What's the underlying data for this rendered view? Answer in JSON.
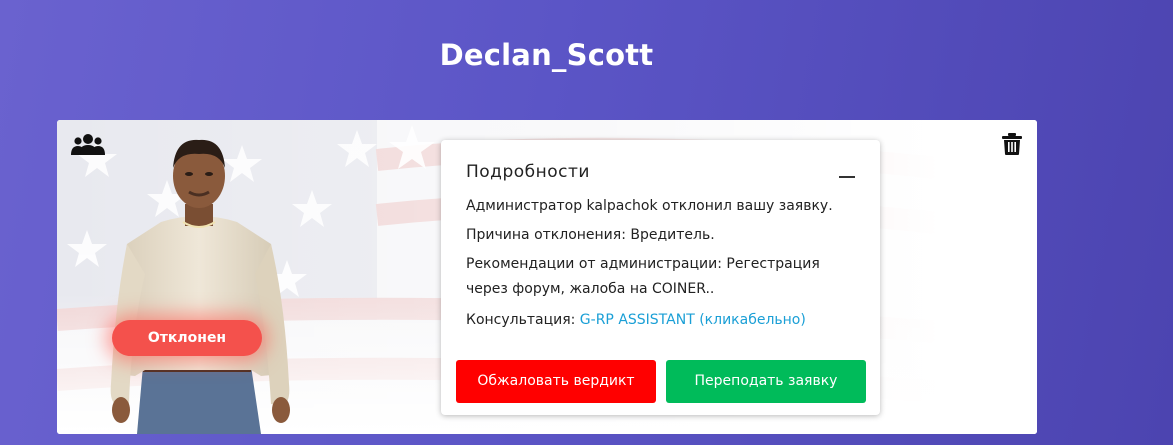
{
  "page": {
    "title": "Declan_Scott"
  },
  "card": {
    "status": "Отклонен",
    "details": {
      "title": "Подробности",
      "lines": [
        "Администратор kalpachok отклонил вашу заявку.",
        "Причина отклонения: Вредитель.",
        "Рекомендации от администрации: Регестрация через форум, жалоба на COINER.."
      ],
      "consultation_label": "Консультация:",
      "consultation_link": "G-RP ASSISTANT (кликабельно)"
    },
    "buttons": {
      "appeal": "Обжаловать вердикт",
      "resubmit": "Переподать заявку"
    }
  },
  "colors": {
    "background_start": "#6a62cf",
    "background_end": "#4c44b0",
    "status_badge": "#f4514c",
    "appeal_button": "#ff0000",
    "resubmit_button": "#00bb5a",
    "link": "#1a9fd6"
  },
  "icons": {
    "top_left": "group-icon",
    "top_right": "trash-icon",
    "collapse": "minus-icon"
  }
}
